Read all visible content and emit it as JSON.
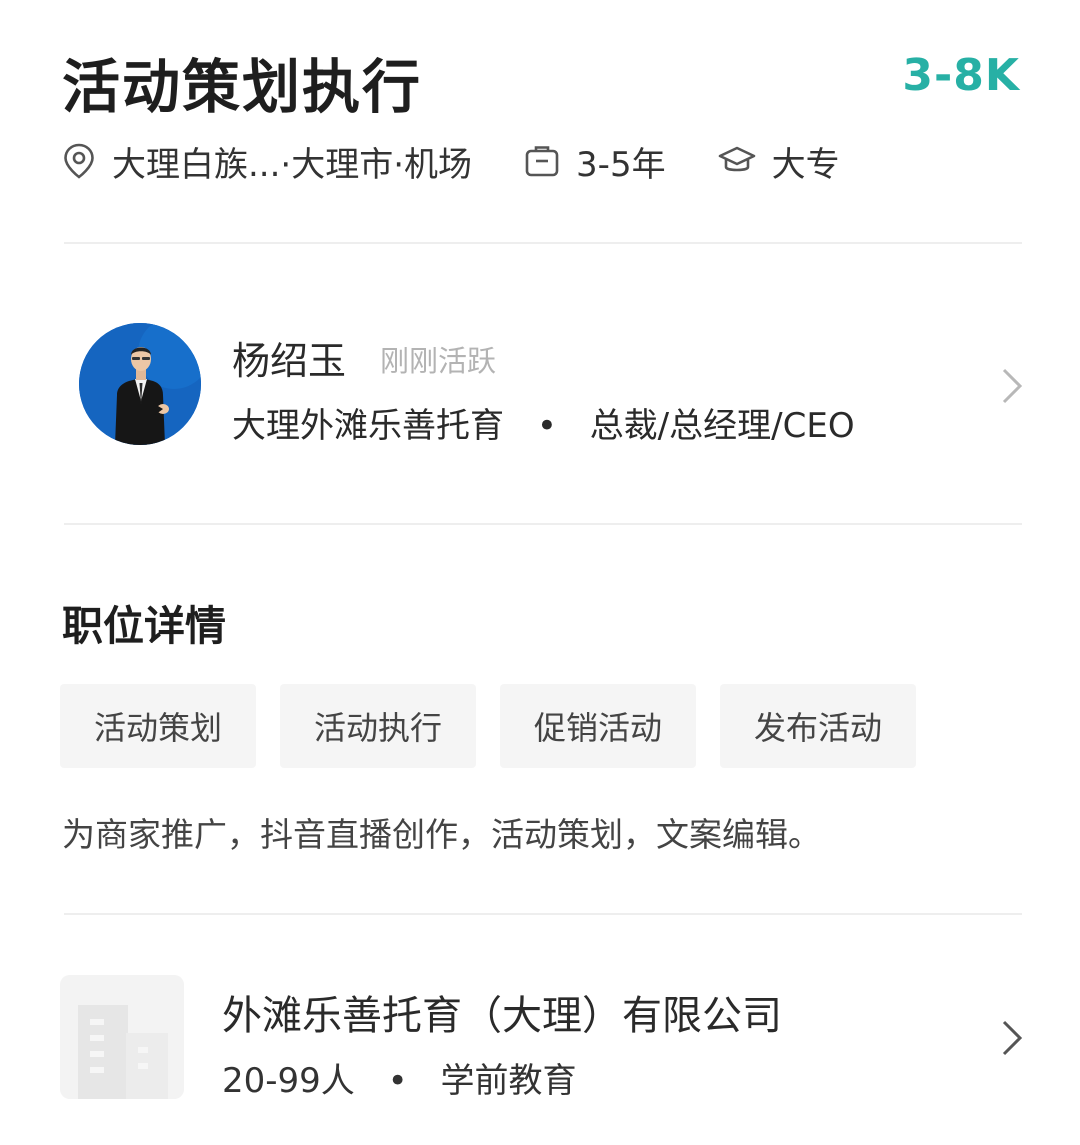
{
  "job": {
    "title": "活动策划执行",
    "salary": "3-8K",
    "location": "大理白族...·大理市·机场",
    "experience": "3-5年",
    "education": "大专"
  },
  "recruiter": {
    "name": "杨绍玉",
    "status": "刚刚活跃",
    "company": "大理外滩乐善托育",
    "separator": "•",
    "position": "总裁/总经理/CEO"
  },
  "details": {
    "title": "职位详情",
    "tags": [
      "活动策划",
      "活动执行",
      "促销活动",
      "发布活动"
    ],
    "description": "为商家推广，抖音直播创作，活动策划，文案编辑。"
  },
  "company": {
    "name": "外滩乐善托育（大理）有限公司",
    "size": "20-99人",
    "separator": "•",
    "industry": "学前教育"
  },
  "icons": {
    "location": "location-pin-icon",
    "experience": "briefcase-icon",
    "education": "graduation-cap-icon",
    "chevron": "chevron-right-icon"
  },
  "colors": {
    "salary": "#27b0a5",
    "divider": "#eeeeee",
    "tag_bg": "#f5f5f5",
    "avatar_bg": "#1565c0"
  }
}
